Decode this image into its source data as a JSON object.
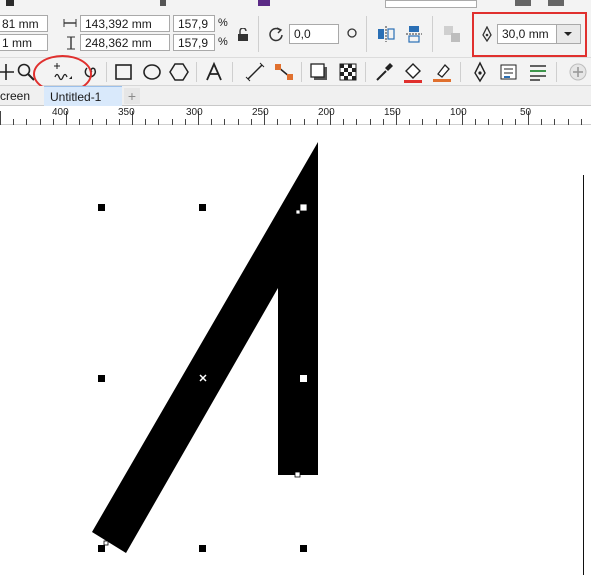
{
  "menu": {
    "cut_off": true
  },
  "property_bar": {
    "pos_x_partial": "81 mm",
    "pos_y_partial": "1 mm",
    "width_value": "143,392 mm",
    "height_value": "248,362 mm",
    "scale_x": "157,9",
    "scale_y": "157,9",
    "percent_symbol": "%",
    "rotation_value": "0,0",
    "outline_width_value": "30,0 mm"
  },
  "toolbox": {
    "tools": [
      "pick-tool",
      "zoom-tool",
      "freehand-tool",
      "artistic-media-tool",
      "rectangle-tool",
      "ellipse-tool",
      "polygon-tool",
      "text-tool",
      "parallel-dimension-tool",
      "connector-tool",
      "drop-shadow-tool",
      "transparency-tool",
      "eyedropper-tool",
      "interactive-fill-tool",
      "smart-fill-tool",
      "outline-pen-tool",
      "object-properties-tool",
      "align-tool",
      "add-tool"
    ],
    "highlighted_tool": "freehand-tool"
  },
  "tabs": {
    "items": [
      {
        "label": "creen",
        "active": false
      },
      {
        "label": "Untitled-1",
        "active": true
      }
    ],
    "add_label": "+"
  },
  "ruler": {
    "labels": [
      "400",
      "350",
      "300",
      "250",
      "200",
      "150",
      "100",
      "50"
    ]
  },
  "accent_colors": {
    "highlight_red": "#e0302e",
    "active_tab": "#d9e9fb",
    "shape_fill": "#000000"
  }
}
